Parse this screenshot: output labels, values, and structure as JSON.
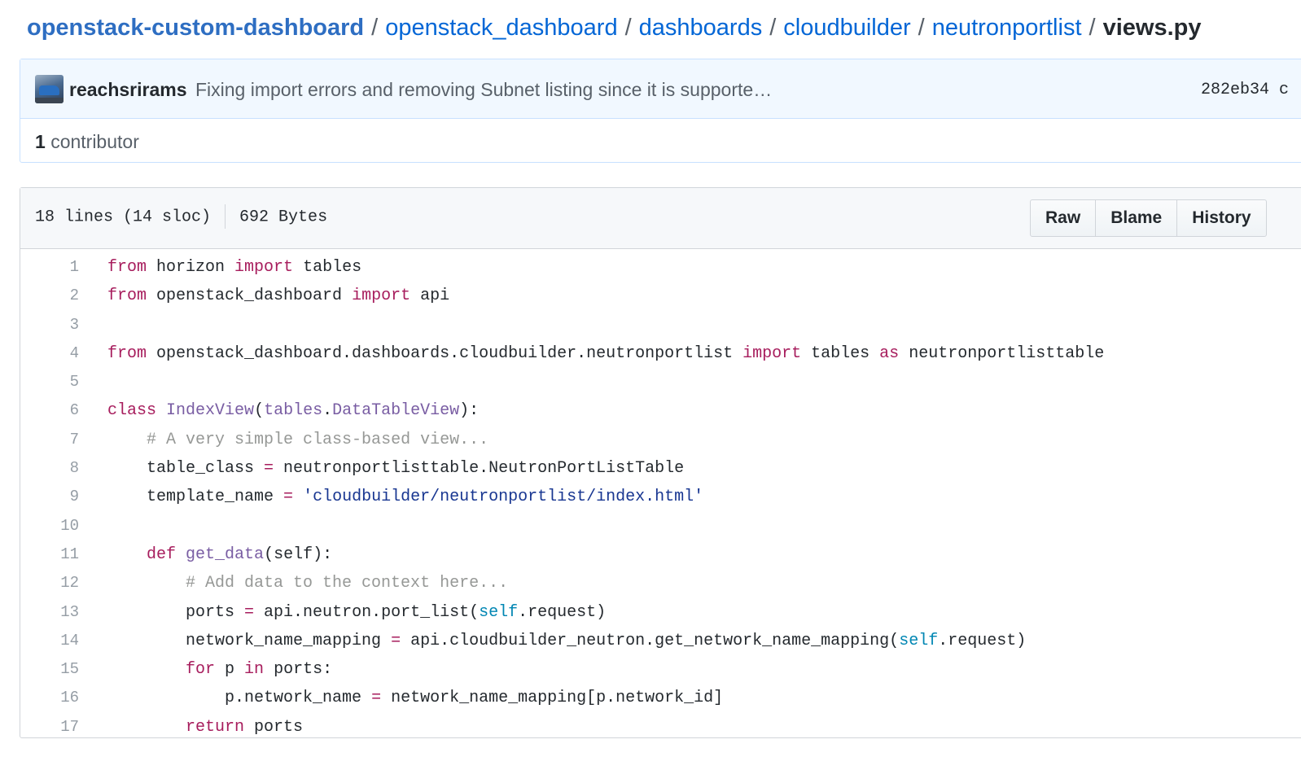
{
  "breadcrumb": {
    "repo": "openstack-custom-dashboard",
    "parts": [
      "openstack_dashboard",
      "dashboards",
      "cloudbuilder",
      "neutronportlist"
    ],
    "separator": "/",
    "file": "views.py"
  },
  "commit": {
    "author": "reachsrirams",
    "message": "Fixing import errors and removing Subnet listing since it is supporte…",
    "sha": "282eb34 c"
  },
  "contributors": {
    "count": "1",
    "label": "contributor"
  },
  "file": {
    "lines_info": "18 lines (14 sloc)",
    "size": "692 Bytes",
    "buttons": {
      "raw": "Raw",
      "blame": "Blame",
      "history": "History"
    }
  },
  "code": [
    [
      [
        "kw",
        "from"
      ],
      [
        "t",
        " horizon "
      ],
      [
        "kw",
        "import"
      ],
      [
        "t",
        " tables"
      ]
    ],
    [
      [
        "kw",
        "from"
      ],
      [
        "t",
        " openstack_dashboard "
      ],
      [
        "kw",
        "import"
      ],
      [
        "t",
        " api"
      ]
    ],
    [],
    [
      [
        "kw",
        "from"
      ],
      [
        "t",
        " openstack_dashboard.dashboards.cloudbuilder.neutronportlist "
      ],
      [
        "kw",
        "import"
      ],
      [
        "t",
        " tables "
      ],
      [
        "kw",
        "as"
      ],
      [
        "t",
        " neutronportlisttable"
      ]
    ],
    [],
    [
      [
        "kw",
        "class"
      ],
      [
        "t",
        " "
      ],
      [
        "nm",
        "IndexView"
      ],
      [
        "t",
        "("
      ],
      [
        "nm",
        "tables"
      ],
      [
        "t",
        "."
      ],
      [
        "nm",
        "DataTableView"
      ],
      [
        "t",
        "):"
      ]
    ],
    [
      [
        "t",
        "    "
      ],
      [
        "cm",
        "# A very simple class-based view..."
      ]
    ],
    [
      [
        "t",
        "    table_class "
      ],
      [
        "op",
        "="
      ],
      [
        "t",
        " neutronportlisttable.NeutronPortListTable"
      ]
    ],
    [
      [
        "t",
        "    template_name "
      ],
      [
        "op",
        "="
      ],
      [
        "t",
        " "
      ],
      [
        "st",
        "'cloudbuilder/neutronportlist/index.html'"
      ]
    ],
    [],
    [
      [
        "t",
        "    "
      ],
      [
        "kw",
        "def"
      ],
      [
        "t",
        " "
      ],
      [
        "nm",
        "get_data"
      ],
      [
        "t",
        "(self):"
      ]
    ],
    [
      [
        "t",
        "        "
      ],
      [
        "cm",
        "# Add data to the context here..."
      ]
    ],
    [
      [
        "t",
        "        ports "
      ],
      [
        "op",
        "="
      ],
      [
        "t",
        " api.neutron.port_list("
      ],
      [
        "bi",
        "self"
      ],
      [
        "t",
        ".request)"
      ]
    ],
    [
      [
        "t",
        "        network_name_mapping "
      ],
      [
        "op",
        "="
      ],
      [
        "t",
        " api.cloudbuilder_neutron.get_network_name_mapping("
      ],
      [
        "bi",
        "self"
      ],
      [
        "t",
        ".request)"
      ]
    ],
    [
      [
        "t",
        "        "
      ],
      [
        "kw",
        "for"
      ],
      [
        "t",
        " p "
      ],
      [
        "kw",
        "in"
      ],
      [
        "t",
        " ports:"
      ]
    ],
    [
      [
        "t",
        "            p.network_name "
      ],
      [
        "op",
        "="
      ],
      [
        "t",
        " network_name_mapping[p.network_id]"
      ]
    ],
    [
      [
        "t",
        "        "
      ],
      [
        "kw",
        "return"
      ],
      [
        "t",
        " ports"
      ]
    ]
  ]
}
